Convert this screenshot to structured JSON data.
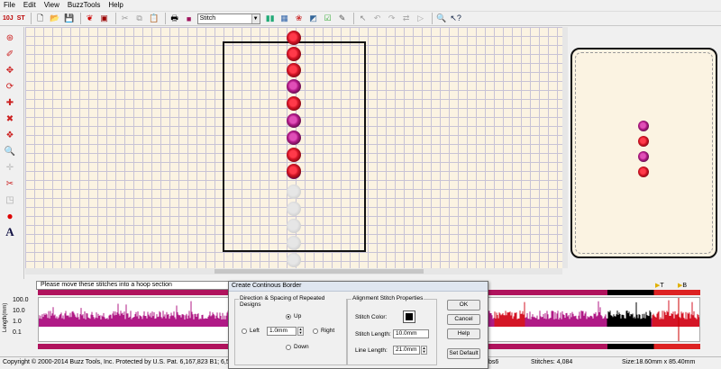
{
  "menu": [
    "File",
    "Edit",
    "View",
    "BuzzTools",
    "Help"
  ],
  "toolbar": {
    "badge_1": "10J",
    "badge_2": "ST",
    "mode_value": "Stitch"
  },
  "status_message": "Please move these stitches into a hoop section",
  "graph": {
    "ylabel": "Length(mm)",
    "ticks": [
      "100.0",
      "10.0",
      "1.0",
      "0.1"
    ],
    "markers": [
      "T",
      "B"
    ]
  },
  "dialog": {
    "title": "Create Continous Border",
    "direction_group": "Direction & Spacing of Repeated Designs",
    "up": "Up",
    "left": "Left",
    "right": "Right",
    "down": "Down",
    "spacing_value": "1.0mm",
    "alignment_group": "Alignment Stitch Properties",
    "stitch_color": "Stitch Color:",
    "stitch_length_label": "Stitch Length:",
    "stitch_length_value": "10.0mm",
    "line_length_label": "Line Length:",
    "line_length_value": "21.0mm",
    "ok": "OK",
    "cancel": "Cancel",
    "help": "Help",
    "set_default": "Set Default"
  },
  "statusbar": {
    "copyright": "Copyright © 2000-2014 Buzz Tools, Inc. Protected by U.S. Pat. 6,167,823 B1; 6,502,006",
    "file": "bs6",
    "stitches": "Stitches: 4,084",
    "size": "Size:18.60mm x 85.40mm"
  },
  "colors": {
    "red": "#d41526",
    "magenta": "#b01a86",
    "canvas": "#fbf3e2",
    "grid": "#c8c3d6"
  }
}
